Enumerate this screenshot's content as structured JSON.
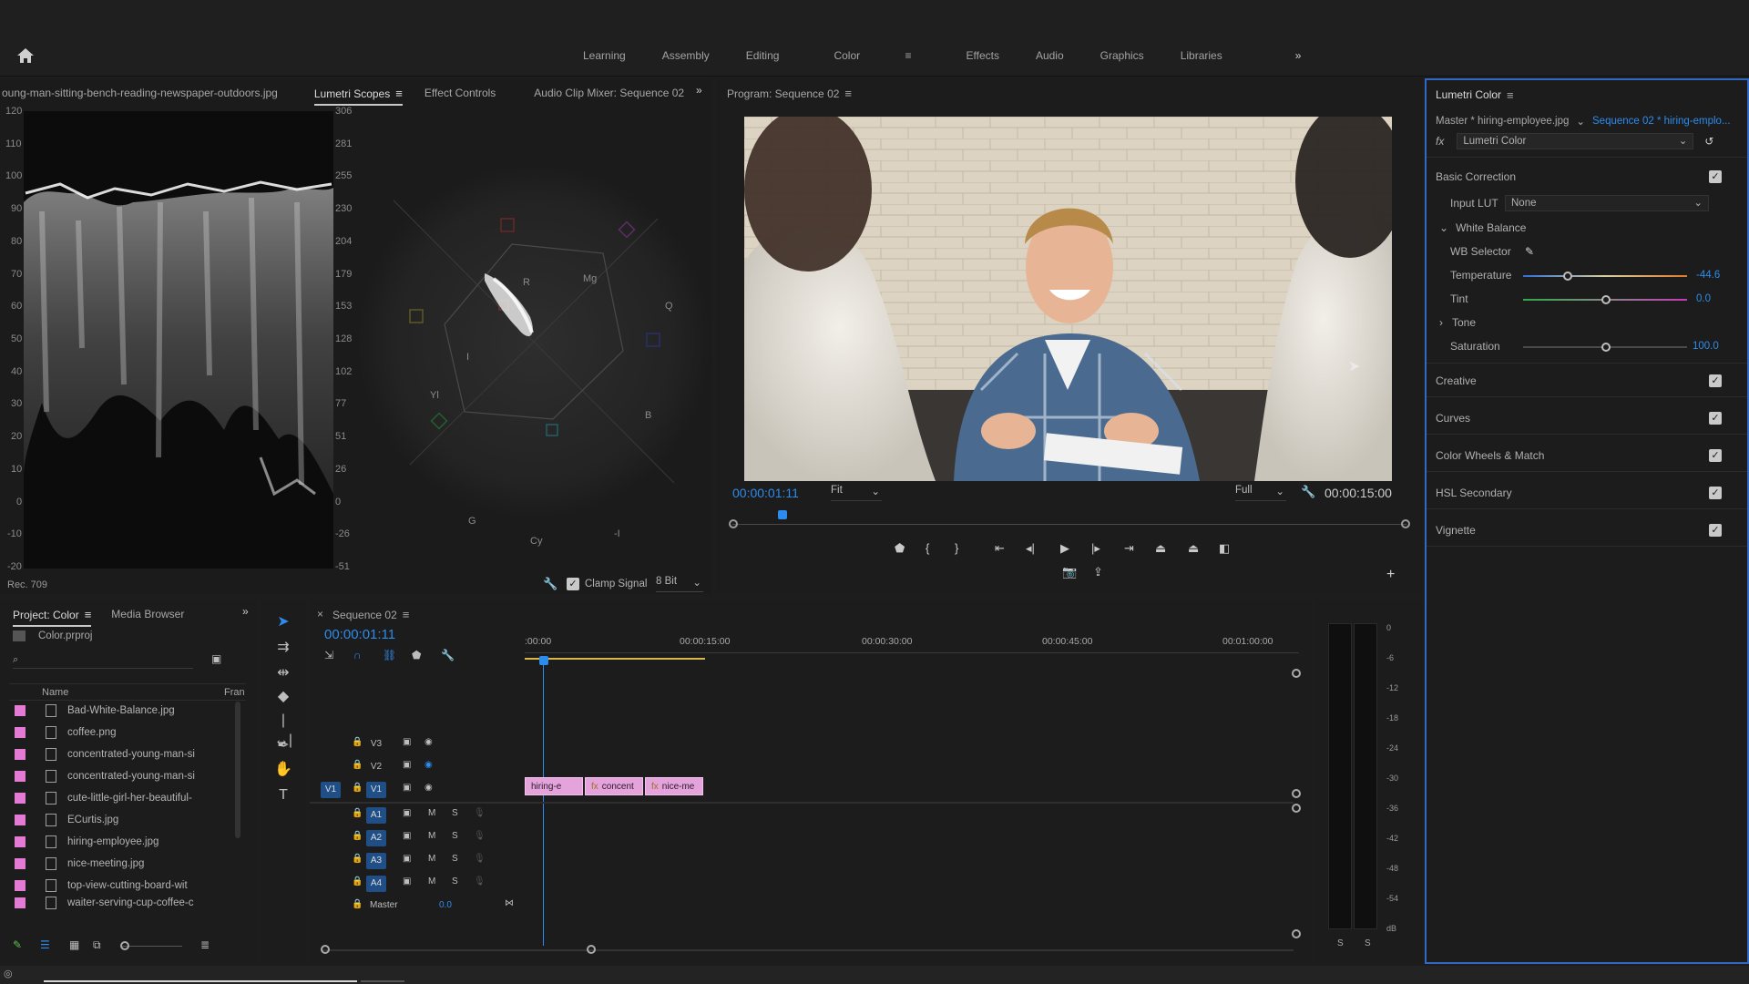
{
  "topbar": {
    "workspaces": [
      "Learning",
      "Assembly",
      "Editing",
      "Color",
      "Effects",
      "Audio",
      "Graphics",
      "Libraries"
    ],
    "active_workspace": "Color",
    "overflow": "»"
  },
  "scopes_panel": {
    "tabs": [
      "oung-man-sitting-bench-reading-newspaper-outdoors.jpg",
      "Lumetri Scopes",
      "Effect Controls",
      "Audio Clip Mixer: Sequence 02"
    ],
    "active_tab": "Lumetri Scopes",
    "left_axis": [
      "120",
      "110",
      "100",
      "90",
      "80",
      "70",
      "60",
      "50",
      "40",
      "30",
      "20",
      "10",
      "0",
      "-10",
      "-20"
    ],
    "right_axis": [
      "306",
      "281",
      "255",
      "230",
      "204",
      "179",
      "153",
      "128",
      "102",
      "77",
      "51",
      "26",
      "0",
      "-26",
      "-51"
    ],
    "colorspace": "Rec. 709",
    "clamp_signal_label": "Clamp Signal",
    "bit_depth": "8 Bit",
    "vectorscope_labels": {
      "r": "R",
      "mg": "Mg",
      "b": "B",
      "cy": "Cy",
      "g": "G",
      "yl": "Yl",
      "i": "I",
      "q": "Q",
      "neg_i": "-I"
    }
  },
  "program": {
    "title": "Program: Sequence 02",
    "timecode": "00:00:01:11",
    "duration": "00:00:15:00",
    "fit": "Fit",
    "quality": "Full"
  },
  "lumetri": {
    "title": "Lumetri Color",
    "master_clip": "Master * hiring-employee.jpg",
    "sequence_clip": "Sequence 02 * hiring-emplo...",
    "effect": "Lumetri Color",
    "basic_correction": "Basic Correction",
    "input_lut_label": "Input LUT",
    "input_lut_value": "None",
    "white_balance": "White Balance",
    "wb_selector": "WB Selector",
    "temperature_label": "Temperature",
    "temperature_value": "-44.6",
    "tint_label": "Tint",
    "tint_value": "0.0",
    "tone": "Tone",
    "saturation_label": "Saturation",
    "saturation_value": "100.0",
    "sections": [
      "Creative",
      "Curves",
      "Color Wheels & Match",
      "HSL Secondary",
      "Vignette"
    ]
  },
  "project": {
    "tabs": [
      "Project: Color",
      "Media Browser"
    ],
    "active_tab": "Project: Color",
    "project_file": "Color.prproj",
    "columns": {
      "name": "Name",
      "frame": "Fran"
    },
    "files": [
      "Bad-White-Balance.jpg",
      "coffee.png",
      "concentrated-young-man-si",
      "concentrated-young-man-si",
      "cute-little-girl-her-beautiful-",
      "ECurtis.jpg",
      "hiring-employee.jpg",
      "nice-meeting.jpg",
      "top-view-cutting-board-wit",
      "waiter-serving-cup-coffee-c"
    ]
  },
  "timeline": {
    "title": "Sequence 02",
    "timecode": "00:00:01:11",
    "ruler": [
      ":00:00",
      "00:00:15:00",
      "00:00:30:00",
      "00:00:45:00",
      "00:01:00:00"
    ],
    "video_tracks": [
      "V3",
      "V2",
      "V1"
    ],
    "audio_tracks": [
      "A1",
      "A2",
      "A3",
      "A4"
    ],
    "source_patch": "V1",
    "m_label": "M",
    "s_label": "S",
    "master_label": "Master",
    "master_value": "0.0",
    "clips": [
      {
        "label": "hiring-e"
      },
      {
        "label": "concent"
      },
      {
        "label": "nice-me"
      }
    ]
  },
  "meter": {
    "scale": [
      "0",
      "-6",
      "-12",
      "-18",
      "-24",
      "-30",
      "-36",
      "-42",
      "-48",
      "-54",
      "dB"
    ],
    "solo_left": "S",
    "solo_right": "S"
  },
  "colors": {
    "accent": "#2d8ceb",
    "clip": "#e5a3dc",
    "label_swatch": "#e37ad4",
    "lumetri_border": "#2f68c7"
  }
}
